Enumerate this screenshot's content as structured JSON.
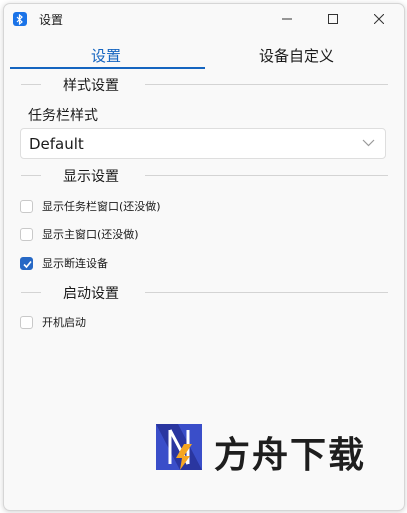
{
  "window": {
    "title": "设置",
    "app_icon": "bluetooth-icon"
  },
  "controls": {
    "minimize_icon": "minimize-icon",
    "maximize_icon": "maximize-icon",
    "close_icon": "close-icon"
  },
  "tabs": [
    {
      "label": "设置",
      "active": true
    },
    {
      "label": "设备自定义",
      "active": false
    }
  ],
  "sections": {
    "style": "样式设置",
    "display": "显示设置",
    "startup": "启动设置"
  },
  "taskbar_style": {
    "label": "任务栏样式",
    "value": "Default"
  },
  "display_options": [
    {
      "label": "显示任务栏窗口(还没做)",
      "checked": false
    },
    {
      "label": "显示主窗口(还没做)",
      "checked": false
    },
    {
      "label": "显示断连设备",
      "checked": true
    }
  ],
  "startup_options": [
    {
      "label": "开机启动",
      "checked": false
    }
  ],
  "watermark": {
    "text": "方舟下载"
  },
  "colors": {
    "accent": "#1565c0",
    "checkbox_checked": "#2668c5"
  }
}
